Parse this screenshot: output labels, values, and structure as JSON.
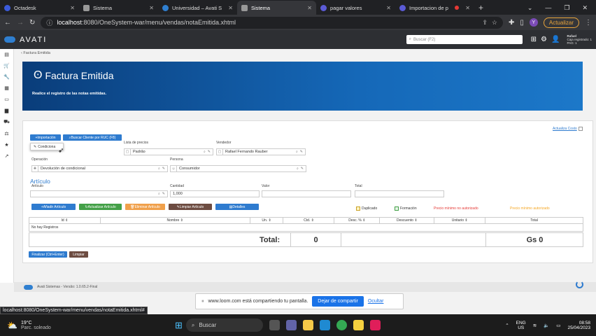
{
  "browser": {
    "tabs": [
      {
        "label": "Octadesk",
        "color": "#3b5bdb"
      },
      {
        "label": "Sistema",
        "color": "#888888"
      },
      {
        "label": "Universidad – Avati S",
        "color": "#2f7fd0"
      },
      {
        "label": "Sistema",
        "color": "#888888"
      },
      {
        "label": "pagar valores",
        "color": "#5b5bd6"
      },
      {
        "label": "Importacion de p",
        "color": "#5b5bd6"
      }
    ],
    "new_tab": "+",
    "url_host": "localhost",
    "url_path": ":8080/OneSystem-war/menu/vendas/notaEmitida.xhtml",
    "update_label": "Actualizar",
    "avatar_letter": "Y"
  },
  "app": {
    "logo": "AVATI",
    "search_placeholder": "Buscar (F2)",
    "user_name": "Rafael",
    "user_line2": "Caja registrado: 1",
    "user_line3": "PAG: 1"
  },
  "page": {
    "breadcrumb": "Factura Emitida",
    "title": "Factura Emitida",
    "subtitle": "Realice el registro de las notas emitidas.",
    "update_cost": "Actualiza Costo"
  },
  "form": {
    "btn_import": "Importación",
    "btn_search_client": "Buscar Cliente por RUC (F8)",
    "menu_conditional": "Condiciona",
    "price_list_label": "Lista de precios",
    "price_list_value": "Padrão",
    "seller_label": "Vendedor",
    "seller_value": "Rafael Fernando Rauber",
    "operation_label": "Operación",
    "operation_value": "Devolución de condicional",
    "person_label": "Persona",
    "person_value": "Consumidor",
    "section_article": "Artículo",
    "article_label": "Artículo",
    "qty_label": "Cantidad",
    "qty_value": "1,000",
    "value_label": "Valor",
    "total_label": "Total"
  },
  "actions": {
    "add": "Añadir Artículo",
    "update": "Actualizar Artículo",
    "remove": "Eliminar Artículo",
    "clean": "Limpiar Artículo",
    "details": "Detalles"
  },
  "legend": {
    "duplicated": "Duplicado",
    "training": "Formación",
    "min_not_auth": "Precio mínimo no autorizado",
    "min_auth": "Precio mínimo autorizado"
  },
  "table": {
    "columns": [
      "Id ⇕",
      "Nombre ⇕",
      "Un. ⇕",
      "Ctd. ⇕",
      "Desc. % ⇕",
      "Descuento ⇕",
      "Unitario ⇕",
      "Total"
    ],
    "empty": "No hay Registros",
    "total_label": "Total:",
    "total_qty": "0",
    "total_amount": "Gs 0"
  },
  "bottom_buttons": {
    "finalize": "Finalizar (Ctrl+Enter)",
    "clean": "Limpiar"
  },
  "footer": {
    "version": "Avati Sistemas - Versão: 1.0.65.2-Final"
  },
  "statusbar": "localhost:8080/OneSystem-war/menu/vendas/notaEmitida.xhtml#",
  "share": {
    "text": "www.loom.com está compartiendo tu pantalla.",
    "stop": "Dejar de compartir",
    "hide": "Ocultar"
  },
  "taskbar": {
    "temp": "19°C",
    "weather": "Parc. soleado",
    "search": "Buscar",
    "lang1": "ENG",
    "lang2": "US",
    "time": "08:58",
    "date": "25/04/2023"
  }
}
